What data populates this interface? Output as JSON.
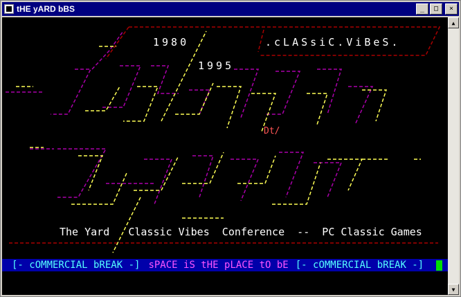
{
  "window": {
    "title": "tHE yARD bBS",
    "buttons": {
      "minimize": "_",
      "maximize": "□",
      "close": "×"
    }
  },
  "art": {
    "years_start": "1980",
    "years_end": "1995",
    "tagline": ".cLASsiC.ViBeS.",
    "artist_tag": "Dt/",
    "conference_line": "The Yard   Classic Vibes  Conference  --  PC Classic Games"
  },
  "statusbar": {
    "left": "[- cOMMERCIAL bREAK -]",
    "middle": "sPACE iS tHE pLACE tO bE",
    "right": "[- cOMMERCIAL bREAK -]"
  },
  "colors": {
    "magenta": "#aa00aa",
    "yellow": "#ffff55",
    "red": "#aa0000",
    "blue_bar": "#0000aa"
  }
}
